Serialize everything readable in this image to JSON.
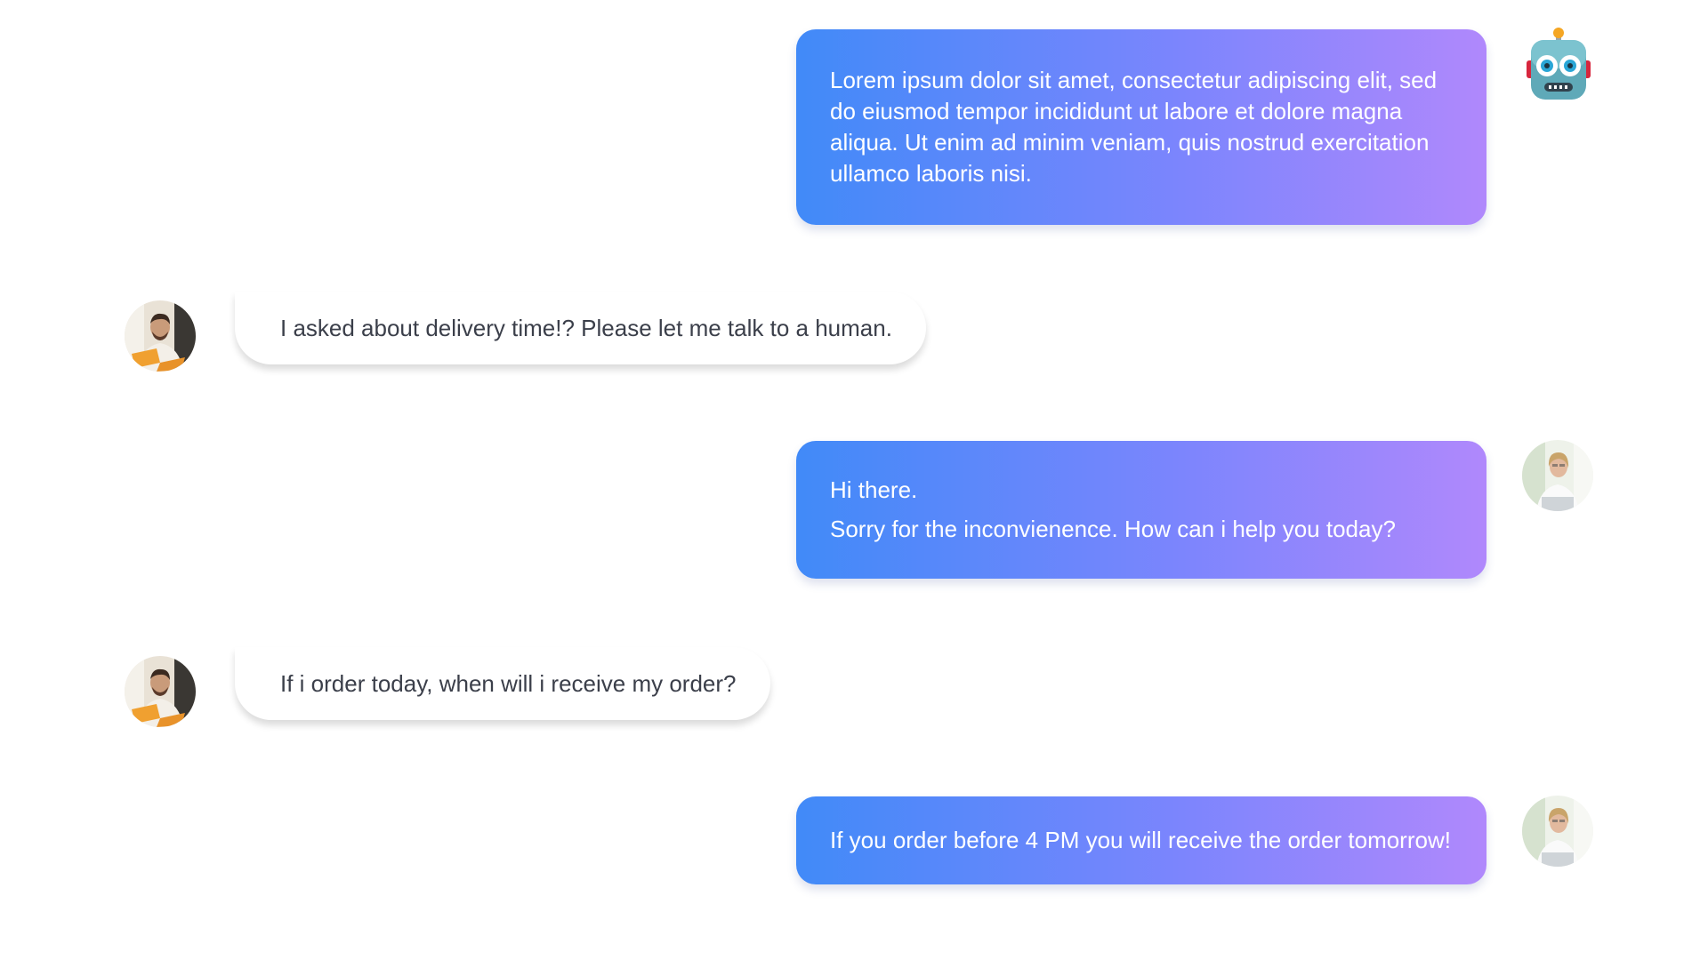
{
  "conversation": {
    "messages": [
      {
        "sender": "bot",
        "avatar_icon": "robot-icon",
        "lines": [
          "Lorem ipsum dolor sit amet, consectetur adipiscing elit, sed do eiusmod  tempor incididunt ut labore et dolore magna aliqua. Ut enim ad minim  veniam, quis nostrud exercitation ullamco laboris nisi."
        ]
      },
      {
        "sender": "customer",
        "avatar_icon": "customer-avatar",
        "text": "I asked about delivery time!? Please let me talk to a human."
      },
      {
        "sender": "agent",
        "avatar_icon": "agent-avatar",
        "lines": [
          "Hi there.",
          "Sorry for the inconvienence. How can i help you today?"
        ]
      },
      {
        "sender": "customer",
        "avatar_icon": "customer-avatar",
        "text": "If i order today, when will i receive my order?"
      },
      {
        "sender": "agent",
        "avatar_icon": "agent-avatar",
        "lines": [
          "If you order before 4 PM you will receive the order tomorrow!"
        ]
      }
    ]
  },
  "colors": {
    "outgoing_gradient_start": "#418af8",
    "outgoing_gradient_end": "#b088fc",
    "incoming_bubble": "#ffffff",
    "incoming_text": "#3b3f4a",
    "outgoing_text": "#ffffff"
  }
}
